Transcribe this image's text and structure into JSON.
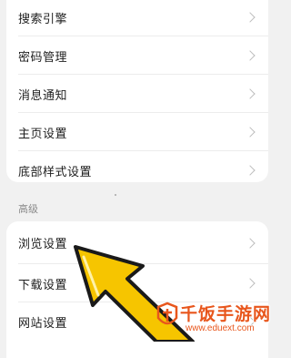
{
  "settings": {
    "top_rows": [
      {
        "label": "搜索引擎"
      },
      {
        "label": "密码管理"
      },
      {
        "label": "消息通知"
      },
      {
        "label": "主页设置"
      },
      {
        "label": "底部样式设置"
      }
    ],
    "advanced_header": "高级",
    "advanced_rows": [
      {
        "label": "浏览设置"
      },
      {
        "label": "下载设置"
      },
      {
        "label": "网站设置"
      }
    ]
  },
  "watermark": {
    "title": "千饭手游网",
    "url": "www.eduext.com"
  },
  "colors": {
    "background": "#f1f1f1",
    "card": "#ffffff",
    "arrow_fill": "#f6c500",
    "arrow_stroke": "#1a1a1a",
    "watermark": "#e8561c"
  }
}
